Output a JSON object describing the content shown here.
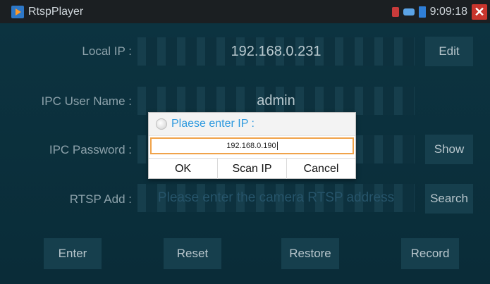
{
  "statusbar": {
    "app_title": "RtspPlayer",
    "time": "9:09:18",
    "close_glyph": "✕"
  },
  "form": {
    "local_ip_label": "Local IP :",
    "local_ip_value": "192.168.0.231",
    "user_label": "IPC User Name :",
    "user_value": "admin",
    "password_label": "IPC Password :",
    "rtsp_label": "RTSP Add :",
    "rtsp_placeholder": "Please enter the camera RTSP address"
  },
  "buttons": {
    "edit": "Edit",
    "show": "Show",
    "search": "Search",
    "enter": "Enter",
    "reset": "Reset",
    "restore": "Restore",
    "record": "Record"
  },
  "dialog": {
    "title": "Plaese enter IP :",
    "input_value": "192.168.0.190",
    "ok": "OK",
    "scan_ip": "Scan IP",
    "cancel": "Cancel"
  },
  "colors": {
    "background": "#0b2b36",
    "accent": "#2e9adf",
    "close": "#c9352d",
    "input_focus": "#f0a34a"
  }
}
